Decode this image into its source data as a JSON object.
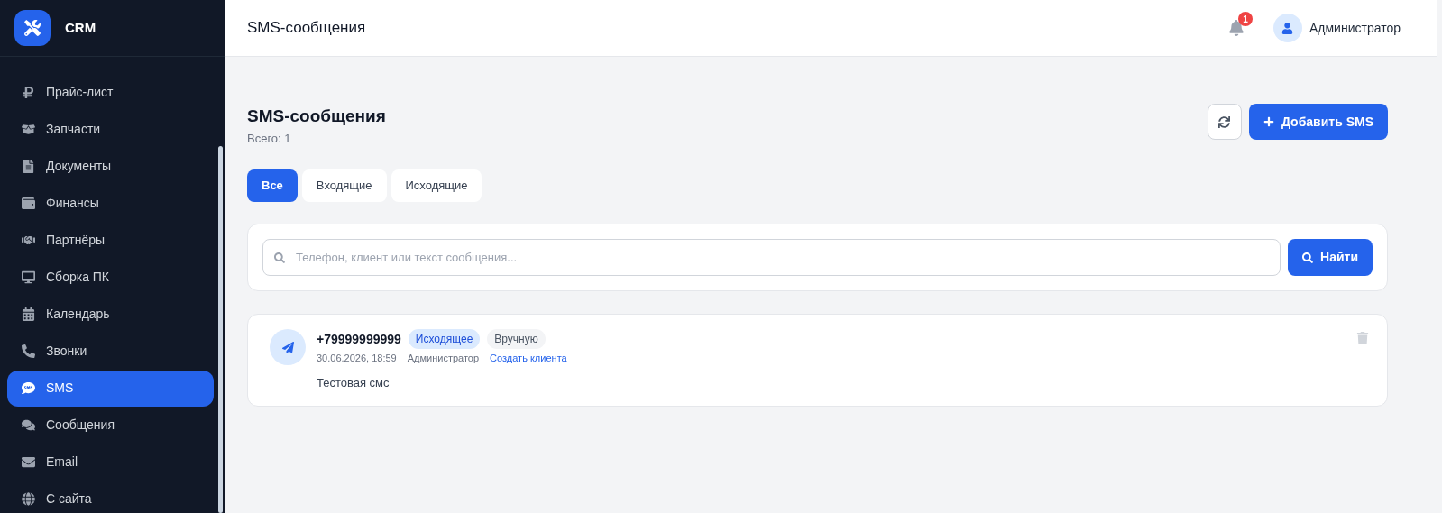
{
  "sidebar": {
    "logo": "CRM",
    "items": [
      {
        "label": "Прайс-лист",
        "selected": false
      },
      {
        "label": "Запчасти",
        "selected": false
      },
      {
        "label": "Документы",
        "selected": false
      },
      {
        "label": "Финансы",
        "selected": false
      },
      {
        "label": "Партнёры",
        "selected": false
      },
      {
        "label": "Сборка ПК",
        "selected": false
      },
      {
        "label": "Календарь",
        "selected": false
      },
      {
        "label": "Звонки",
        "selected": false
      },
      {
        "label": "SMS",
        "selected": true
      },
      {
        "label": "Сообщения",
        "selected": false
      },
      {
        "label": "Email",
        "selected": false
      },
      {
        "label": "С сайта",
        "selected": false
      }
    ]
  },
  "header": {
    "title": "SMS-сообщения",
    "notifications": "1",
    "user": "Администратор"
  },
  "page": {
    "title": "SMS-сообщения",
    "total": "Всего: 1",
    "add_button": "Добавить SMS"
  },
  "tabs": [
    {
      "label": "Все",
      "selected": true
    },
    {
      "label": "Входящие",
      "selected": false
    },
    {
      "label": "Исходящие",
      "selected": false
    }
  ],
  "search": {
    "placeholder": "Телефон, клиент или текст сообщения...",
    "button": "Найти"
  },
  "messages": [
    {
      "phone": "+79999999999",
      "tags": [
        {
          "label": "Исходящее",
          "kind": "direction"
        },
        {
          "label": "Вручную",
          "kind": "source"
        }
      ],
      "datetime": "30.06.2026, 18:59",
      "author": "Администратор",
      "link": "Создать клиента",
      "text": "Тестовая смс"
    }
  ]
}
